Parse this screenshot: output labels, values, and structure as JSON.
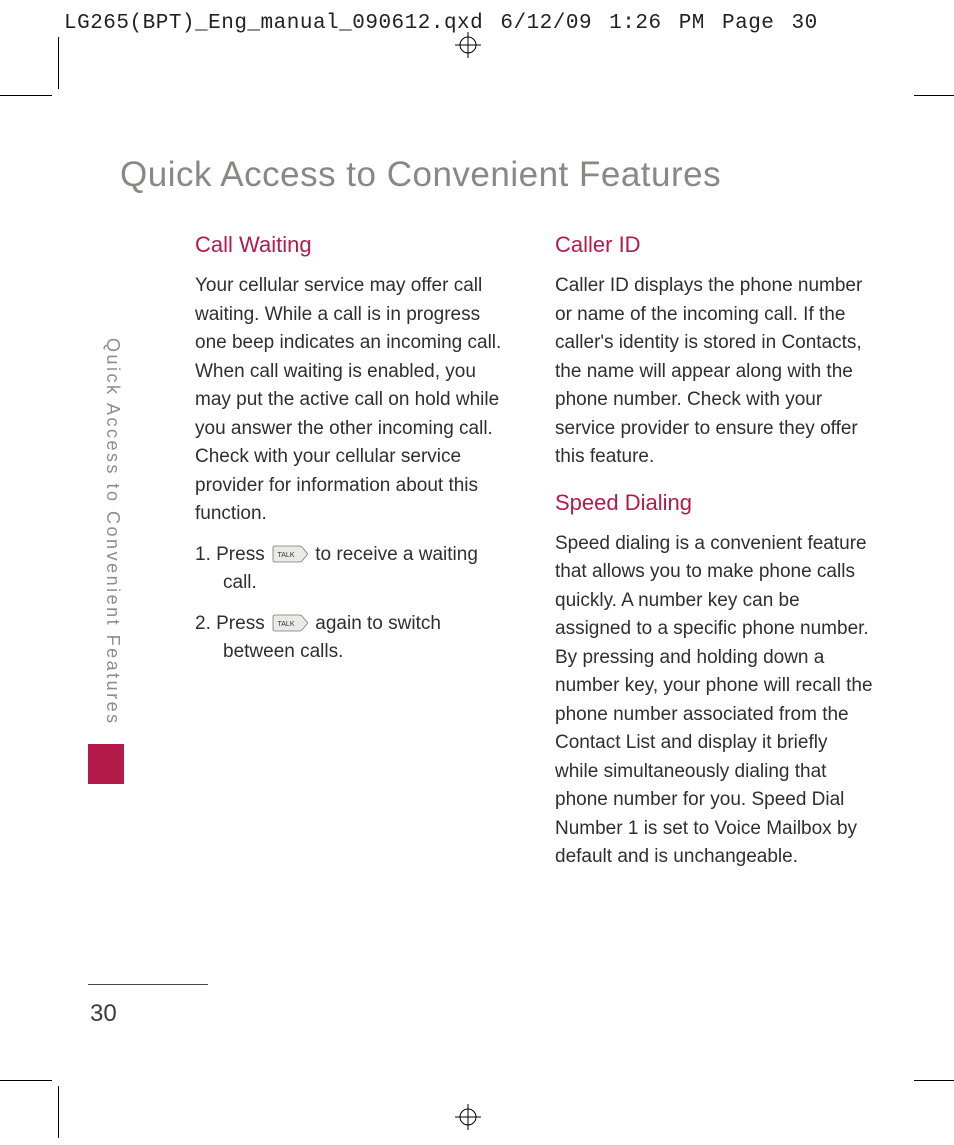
{
  "header": "LG265(BPT)_Eng_manual_090612.qxd  6/12/09  1:26 PM  Page 30",
  "page_title": "Quick Access to Convenient Features",
  "side_label": "Quick Access to Convenient Features",
  "page_number": "30",
  "left": {
    "h1": "Call Waiting",
    "p1": "Your cellular service may offer call waiting. While a call is in progress one beep indicates an incoming call. When call waiting is enabled, you may put the active call on hold while you answer the other incoming call. Check with your cellular service provider for information about this function.",
    "s1a": "1. Press",
    "s1b": "to receive a waiting call.",
    "s2a": "2. Press",
    "s2b": "again to switch between calls."
  },
  "right": {
    "h1": "Caller ID",
    "p1": "Caller ID displays the phone number or name of the incoming call. If the caller's identity is stored in Contacts, the name will appear along with the phone number. Check with your service provider to ensure they offer this feature.",
    "h2": "Speed Dialing",
    "p2": "Speed dialing is a convenient feature that allows you to make phone calls quickly. A number key can be assigned to a specific phone number. By pressing and holding down a number key, your phone will recall the phone number associated from the Contact List and display it briefly while simultaneously dialing that phone number for you. Speed Dial Number 1 is set to Voice Mailbox by default and is unchangeable."
  },
  "icons": {
    "talk_key_label": "TALK"
  }
}
